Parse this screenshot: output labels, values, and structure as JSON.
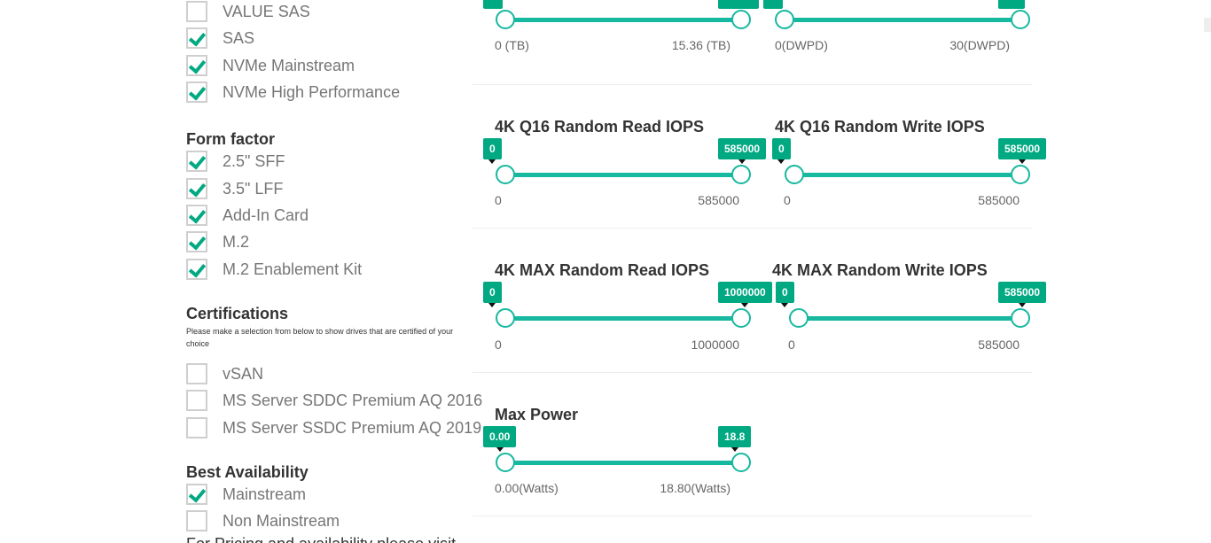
{
  "interface": {
    "items": [
      {
        "label": "VALUE SAS",
        "checked": false
      },
      {
        "label": "SAS",
        "checked": true
      },
      {
        "label": "NVMe Mainstream",
        "checked": true
      },
      {
        "label": "NVMe High Performance",
        "checked": true
      }
    ]
  },
  "form_factor": {
    "title": "Form factor",
    "items": [
      {
        "label": "2.5\" SFF",
        "checked": true
      },
      {
        "label": "3.5\" LFF",
        "checked": true
      },
      {
        "label": "Add-In Card",
        "checked": true
      },
      {
        "label": "M.2",
        "checked": true
      },
      {
        "label": "M.2 Enablement Kit",
        "checked": true
      }
    ]
  },
  "certifications": {
    "title": "Certifications",
    "note": "Please make a selection from below to show drives that are certified of your choice",
    "items": [
      {
        "label": "vSAN",
        "checked": false
      },
      {
        "label": "MS Server SDDC Premium AQ 2016",
        "checked": false
      },
      {
        "label": "MS Server SSDC Premium AQ 2019",
        "checked": false
      }
    ]
  },
  "availability": {
    "title": "Best Availability",
    "items": [
      {
        "label": "Mainstream",
        "checked": true
      },
      {
        "label": "Non Mainstream",
        "checked": false
      }
    ],
    "cut_text": "For Pricing and availability please visit"
  },
  "sliders": {
    "capacity": {
      "min_label": "0 (TB)",
      "max_label": "15.36 (TB)"
    },
    "endurance": {
      "min_label": "0(DWPD)",
      "max_label": "30(DWPD)"
    },
    "q16_read": {
      "title": "4K Q16 Random Read IOPS",
      "low": "0",
      "high": "585000",
      "min_label": "0",
      "max_label": "585000"
    },
    "q16_write": {
      "title": "4K Q16 Random Write IOPS",
      "low": "0",
      "high": "585000",
      "min_label": "0",
      "max_label": "585000"
    },
    "max_read": {
      "title": "4K MAX Random Read IOPS",
      "low": "0",
      "high": "1000000",
      "min_label": "0",
      "max_label": "1000000"
    },
    "max_write": {
      "title": "4K MAX Random Write IOPS",
      "low": "0",
      "high": "585000",
      "min_label": "0",
      "max_label": "585000"
    },
    "max_power": {
      "title": "Max Power",
      "low": "0.00",
      "high": "18.8",
      "min_label": "0.00(Watts)",
      "max_label": "18.80(Watts)"
    }
  },
  "colors": {
    "accent": "#01a982",
    "track": "#17b8a0",
    "text_muted": "#767676"
  }
}
